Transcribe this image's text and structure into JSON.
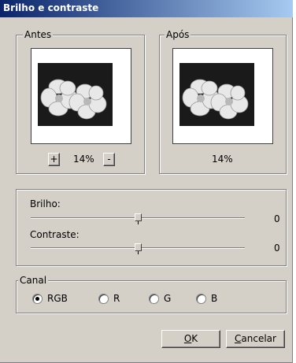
{
  "window": {
    "title": "Brilho e contraste"
  },
  "before": {
    "label": "Antes",
    "zoom": "14%",
    "zoom_in": "+",
    "zoom_out": "-"
  },
  "after": {
    "label": "Após",
    "zoom": "14%"
  },
  "adjust": {
    "brightness": {
      "label": "Brilho:",
      "value": "0"
    },
    "contrast": {
      "label": "Contraste:",
      "value": "0"
    }
  },
  "channel": {
    "label": "Canal",
    "selected": "RGB",
    "options": [
      "RGB",
      "R",
      "G",
      "B"
    ]
  },
  "buttons": {
    "ok_accel": "O",
    "ok_rest": "K",
    "cancel_accel": "C",
    "cancel_rest": "ancelar"
  }
}
